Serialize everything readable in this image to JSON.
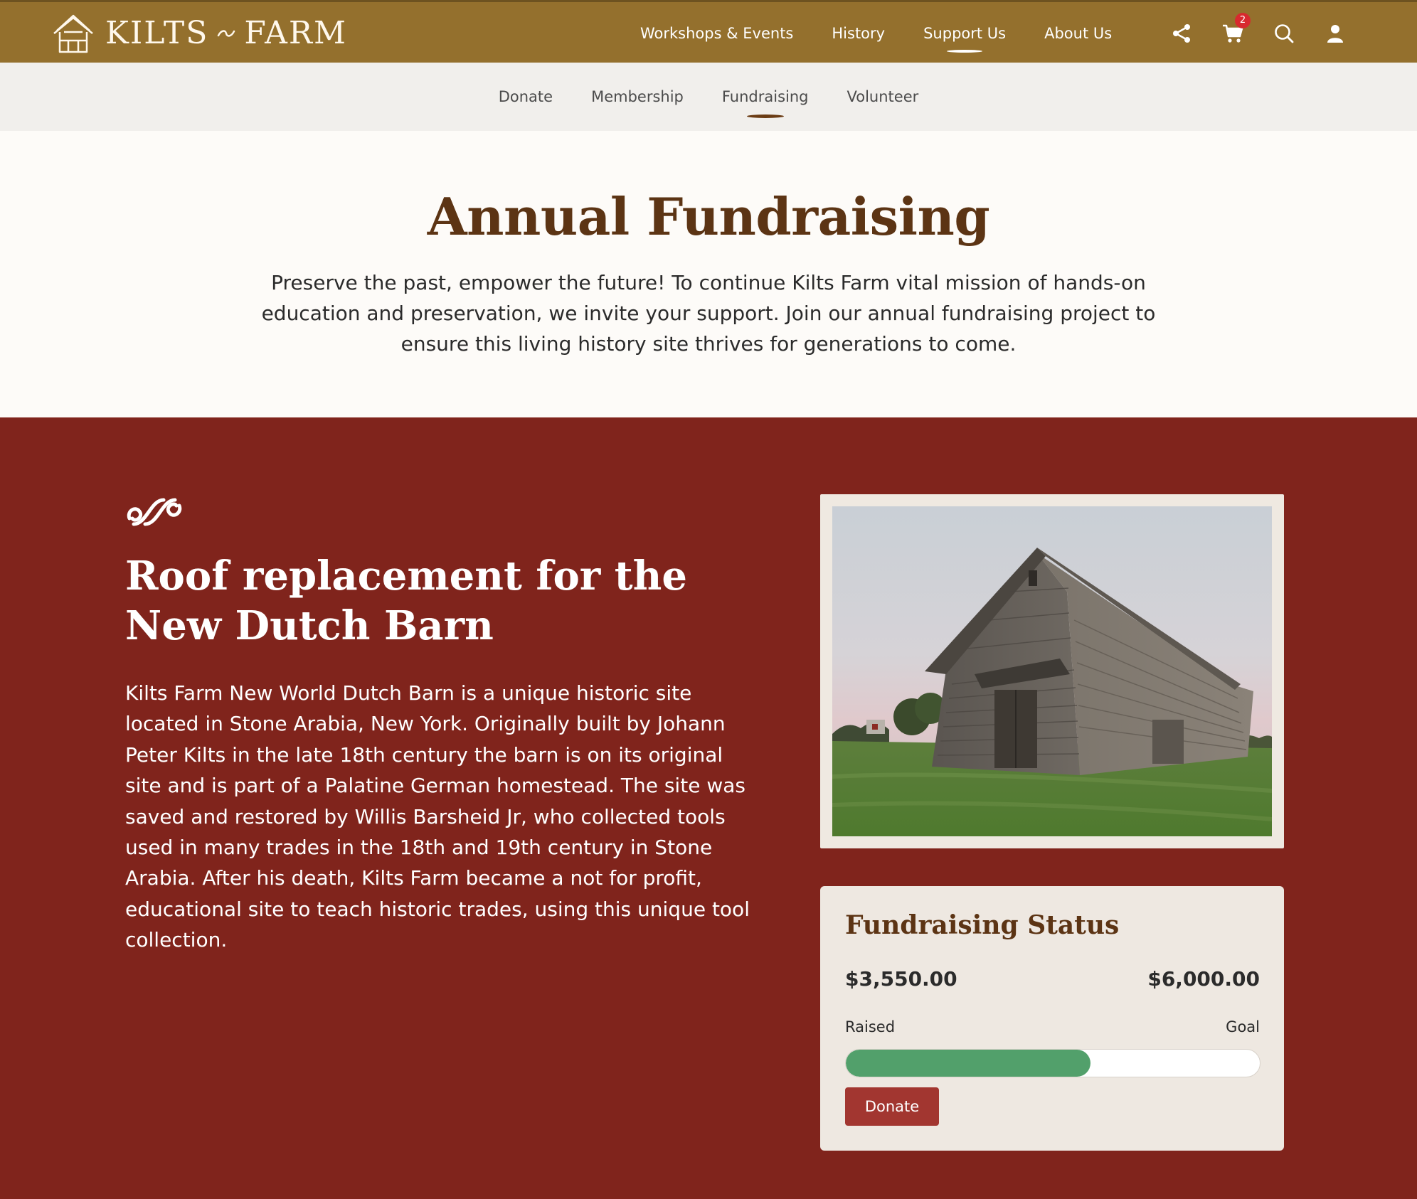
{
  "brand": {
    "name_left": "KILTS",
    "name_right": "FARM",
    "logo_icon": "barn-icon",
    "header_color": "#94702d"
  },
  "main_nav": [
    {
      "label": "Workshops & Events",
      "active": false
    },
    {
      "label": "History",
      "active": false
    },
    {
      "label": "Support Us",
      "active": true
    },
    {
      "label": "About Us",
      "active": false
    }
  ],
  "header_icons": {
    "share": "share-icon",
    "cart": "cart-icon",
    "cart_count": "2",
    "search": "search-icon",
    "account": "user-icon"
  },
  "sub_nav": [
    {
      "label": "Donate",
      "active": false
    },
    {
      "label": "Membership",
      "active": false
    },
    {
      "label": "Fundraising",
      "active": true
    },
    {
      "label": "Volunteer",
      "active": false
    }
  ],
  "intro": {
    "title": "Annual Fundraising",
    "text": "Preserve the past, empower the future! To continue Kilts Farm vital mission of hands-on education and preservation, we invite your support. Join our annual fundraising project to ensure this living history site thrives for generations to come."
  },
  "project": {
    "title": "Roof replacement for the New Dutch Barn",
    "description": "Kilts Farm New World Dutch Barn is a unique historic site located in Stone Arabia, New York. Originally built by Johann Peter Kilts in the late 18th century the barn is on its original site and is part of a Palatine German homestead. The site was saved and restored by Willis Barsheid Jr, who collected tools used in many trades in the 18th and 19th century in Stone Arabia. After his death, Kilts Farm became a not for profit, educational site to teach historic trades, using this unique tool collection.",
    "section_color": "#80241c"
  },
  "status": {
    "title": "Fundraising Status",
    "raised": "$3,550.00",
    "goal": "$6,000.00",
    "raised_label": "Raised",
    "goal_label": "Goal",
    "progress_fraction": 0.5917,
    "progress_color": "#52a06b",
    "donate_label": "Donate"
  }
}
